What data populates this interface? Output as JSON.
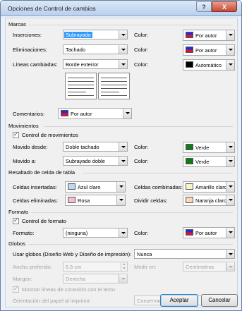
{
  "window": {
    "title": "Opciones de Control de cambios",
    "help_label": "?",
    "close_label": "X"
  },
  "marcas": {
    "heading": "Marcas",
    "inserciones": {
      "label": "Inserciones:",
      "value": "Subrayado",
      "color_label": "Color:",
      "color_value": "Por autor"
    },
    "eliminaciones": {
      "label": "Eliminaciones:",
      "value": "Tachado",
      "color_label": "Color:",
      "color_value": "Por autor"
    },
    "lineas": {
      "label": "Líneas cambiadas:",
      "value": "Borde exterior",
      "color_label": "Color:",
      "color_value": "Automático"
    },
    "comentarios": {
      "label": "Comentarios:",
      "color_value": "Por autor"
    }
  },
  "movimientos": {
    "heading": "Movimientos",
    "control_label": "Control de movimientos",
    "movido_desde": {
      "label": "Movido desde:",
      "value": "Doble tachado",
      "color_label": "Color:",
      "color_value": "Verde"
    },
    "movido_a": {
      "label": "Movido a:",
      "value": "Subrayado doble",
      "color_label": "Color:",
      "color_value": "Verde"
    }
  },
  "resaltado": {
    "heading": "Resaltado de celda de tabla",
    "insertadas": {
      "label": "Celdas insertadas:",
      "value": "Azul claro"
    },
    "combinadas": {
      "label": "Celdas combinadas:",
      "value": "Amarillo claro"
    },
    "eliminadas": {
      "label": "Celdas eliminadas:",
      "value": "Rosa"
    },
    "dividir": {
      "label": "Dividir celdas:",
      "value": "Naranja claro"
    }
  },
  "formato": {
    "heading": "Formato",
    "control_label": "Control de formato",
    "formato": {
      "label": "Formato:",
      "value": "(ninguna)",
      "color_label": "Color:",
      "color_value": "Por autor"
    }
  },
  "globos": {
    "heading": "Globos",
    "usar": {
      "label": "Usar globos (Diseño Web y Diseño de impresión):",
      "value": "Nunca"
    },
    "ancho": {
      "label": "Ancho preferido:",
      "value": "6.5 cm",
      "medir_label": "Medir en:",
      "medir_value": "Centímetros"
    },
    "margen": {
      "label": "Margen:",
      "value": "Derecha"
    },
    "mostrar_label": "Mostrar líneas de conexión con el texto",
    "orientacion": {
      "label": "Orientación del papel al imprimir:",
      "value": "Conservar"
    }
  },
  "buttons": {
    "ok": "Aceptar",
    "cancel": "Cancelar"
  },
  "colors": {
    "author_blue": "#1b2fd8",
    "author_red": "#e0112e",
    "auto_black": "#000000",
    "green": "#0f7a19",
    "light_blue": "#bcd8f5",
    "light_yellow": "#fbf6c8",
    "pink": "#f6bdd1",
    "light_orange": "#fad7bf"
  }
}
